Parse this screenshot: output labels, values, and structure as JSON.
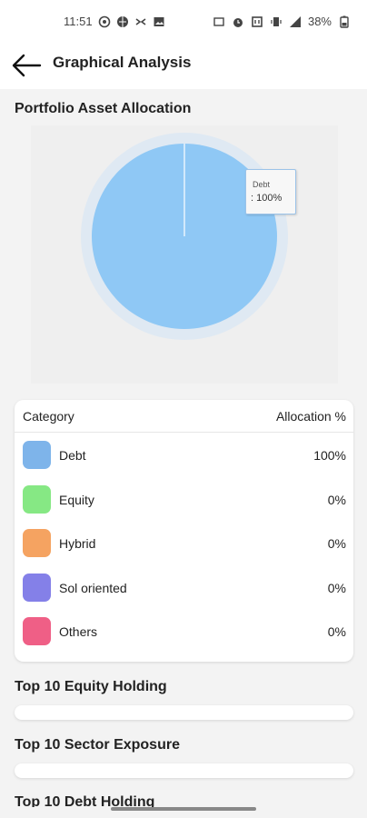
{
  "status_bar": {
    "time": "11:51",
    "battery": "38%"
  },
  "app_bar": {
    "title": "Graphical Analysis"
  },
  "allocation": {
    "title": "Portfolio Asset Allocation",
    "tooltip": {
      "name": "Debt",
      "value": ": 100%"
    }
  },
  "chart_data": {
    "type": "pie",
    "categories": [
      "Debt",
      "Equity",
      "Hybrid",
      "Sol oriented",
      "Others"
    ],
    "values": [
      100,
      0,
      0,
      0,
      0
    ],
    "colors": [
      "#8fc8f5",
      "#86e884",
      "#f5a361",
      "#8480e8",
      "#ef5f86"
    ]
  },
  "table": {
    "header_category": "Category",
    "header_allocation": "Allocation %",
    "rows": [
      {
        "label": "Debt",
        "value": "100%",
        "color": "#7eb4ea"
      },
      {
        "label": "Equity",
        "value": "0%",
        "color": "#86e884"
      },
      {
        "label": "Hybrid",
        "value": "0%",
        "color": "#f5a361"
      },
      {
        "label": "Sol oriented",
        "value": "0%",
        "color": "#8480e8"
      },
      {
        "label": "Others",
        "value": "0%",
        "color": "#ef5f86"
      }
    ]
  },
  "sections": {
    "equity_holding": "Top 10 Equity Holding",
    "sector_exposure": "Top 10 Sector Exposure",
    "debt_holding": "Top 10 Debt Holding"
  }
}
